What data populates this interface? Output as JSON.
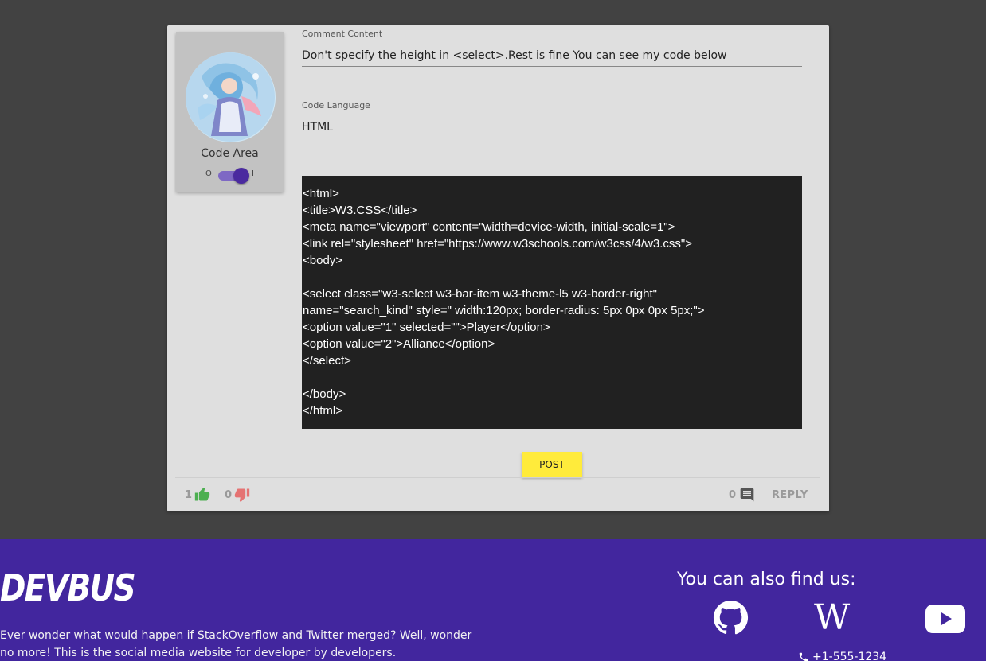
{
  "post": {
    "profile": {
      "code_area_label": "Code Area",
      "toggle_off_label": "O",
      "toggle_on_label": "I"
    },
    "comment_label": "Comment Content",
    "comment_value": "Don't specify the height in <select>.Rest is fine You can see my code below",
    "language_label": "Code Language",
    "language_value": "HTML",
    "code": "<html>\n<title>W3.CSS</title>\n<meta name=\"viewport\" content=\"width=device-width, initial-scale=1\">\n<link rel=\"stylesheet\" href=\"https://www.w3schools.com/w3css/4/w3.css\">\n<body>\n\n<select class=\"w3-select w3-bar-item w3-theme-l5 w3-border-right\"\nname=\"search_kind\" style=\" width:120px; border-radius: 5px 0px 0px 5px;\">\n<option value=\"1\" selected=\"\">Player</option>\n<option value=\"2\">Alliance</option>\n</select>\n\n</body>\n</html>",
    "post_button": "POST",
    "likes": "1",
    "dislikes": "0",
    "comments": "0",
    "reply_label": "REPLY"
  },
  "colors": {
    "accent": "#42269e",
    "like": "#4caf50",
    "dislike": "#e57373",
    "post_button": "#ffeb3b"
  },
  "icons": {
    "like": "thumbs-up-icon",
    "dislike": "thumbs-down-icon",
    "comments": "comment-icon",
    "github": "github-icon",
    "wikipedia": "wikipedia-icon",
    "youtube": "youtube-icon",
    "phone": "phone-icon"
  },
  "footer": {
    "brand": "DEVBUS",
    "blurb": "Ever wonder what would happen if StackOverflow and Twitter merged? Well, wonder no more! This is the social media website for developer by developers.",
    "find_us": "You can also find us:",
    "wikipedia_letter": "W",
    "phone": "+1-555-1234"
  }
}
